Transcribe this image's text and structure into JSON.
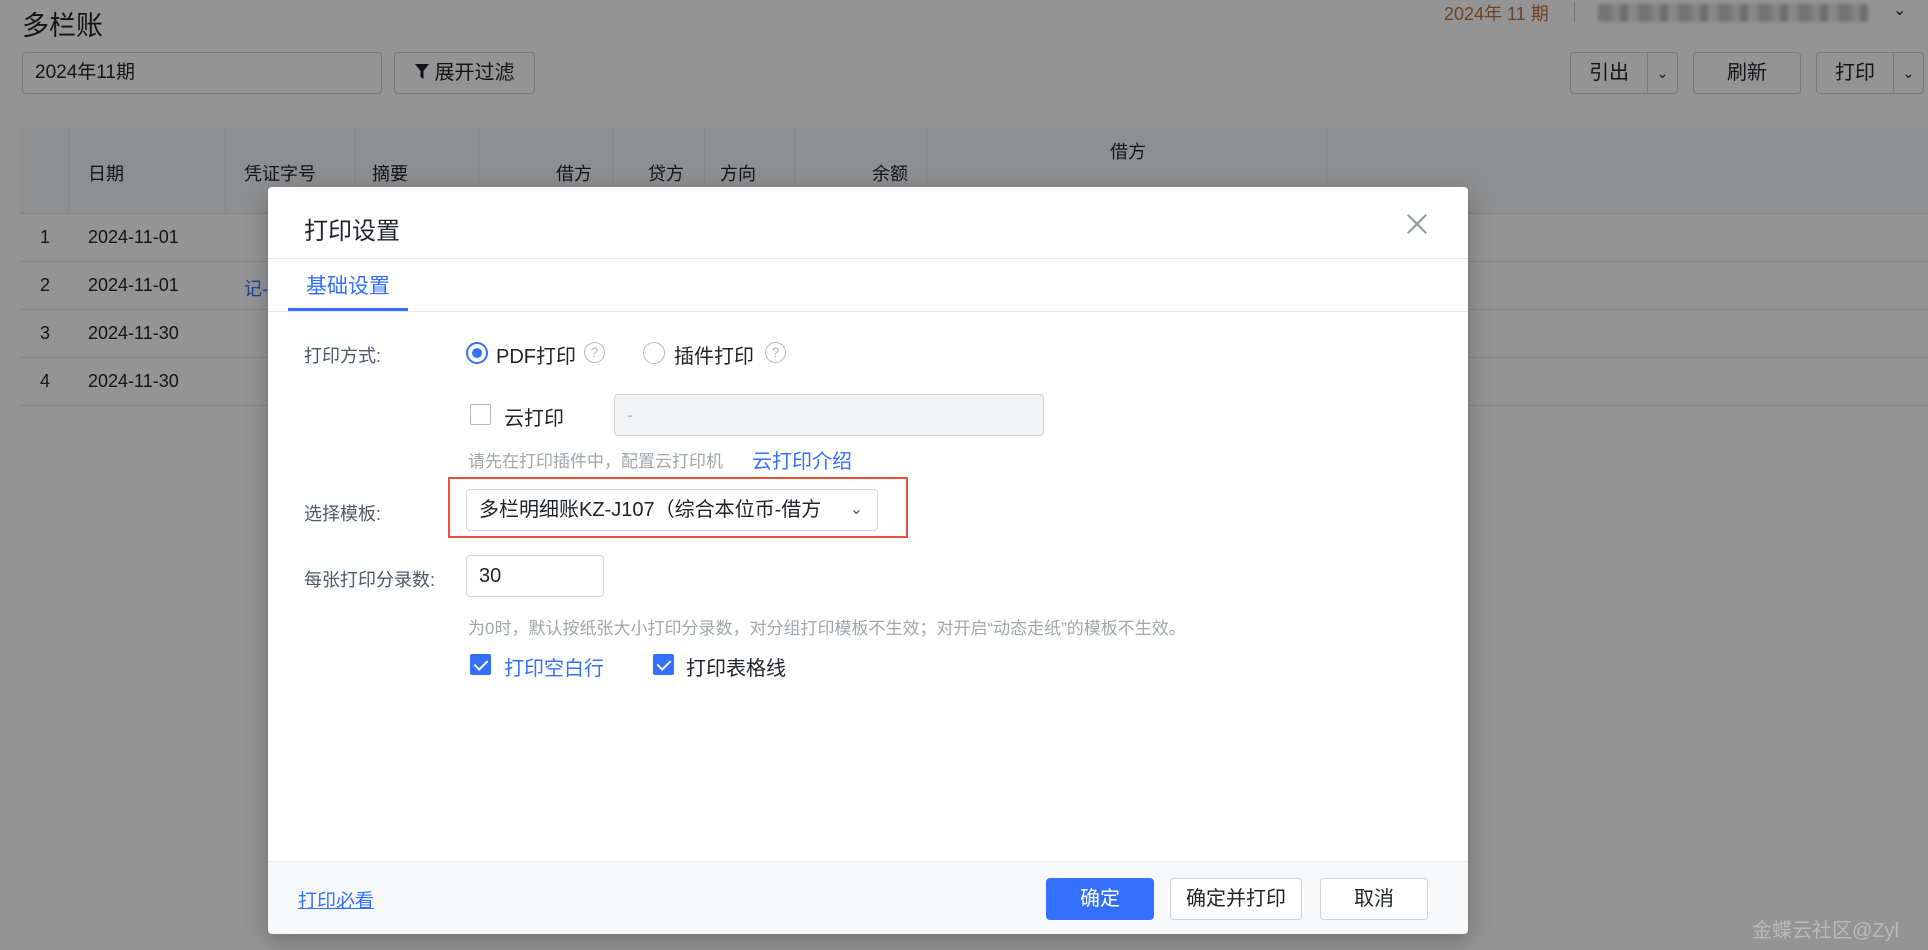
{
  "page": {
    "title": "多栏账",
    "period_label": "2024年 11 期",
    "org_chevron": "⌄",
    "period_value": "2024年11期",
    "filter_label": "展开过滤",
    "export_label": "引出",
    "refresh_label": "刷新",
    "print_label": "打印",
    "caret": "⌄"
  },
  "table": {
    "headers": [
      "日期",
      "凭证字号",
      "摘要",
      "借方",
      "贷方",
      "方向",
      "余额",
      "借方"
    ],
    "rows": [
      {
        "no": "1",
        "date": "2024-11-01",
        "voucher": ""
      },
      {
        "no": "2",
        "date": "2024-11-01",
        "voucher": "记-"
      },
      {
        "no": "3",
        "date": "2024-11-30",
        "voucher": ""
      },
      {
        "no": "4",
        "date": "2024-11-30",
        "voucher": ""
      }
    ]
  },
  "dialog": {
    "title": "打印设置",
    "tab_basic": "基础设置",
    "print_mode_label": "打印方式:",
    "pdf_print": "PDF打印",
    "plugin_print": "插件打印",
    "help_glyph": "?",
    "cloud_print": "云打印",
    "cloud_value": "-",
    "cloud_hint": "请先在打印插件中，配置云打印机",
    "cloud_intro_link": "云打印介绍",
    "template_label": "选择模板:",
    "template_value": "多栏明细账KZ-J107（综合本位币-借方",
    "template_chevron": "⌄",
    "count_label": "每张打印分录数:",
    "count_value": "30",
    "count_hint": "为0时，默认按纸张大小打印分录数，对分组打印模板不生效；对开启“动态走纸”的模板不生效。",
    "print_blank_rows": "打印空白行",
    "print_grid_lines": "打印表格线",
    "must_read": "打印必看",
    "ok": "确定",
    "ok_print": "确定并打印",
    "cancel": "取消"
  },
  "watermark": "金蝶云社区@Zyl"
}
